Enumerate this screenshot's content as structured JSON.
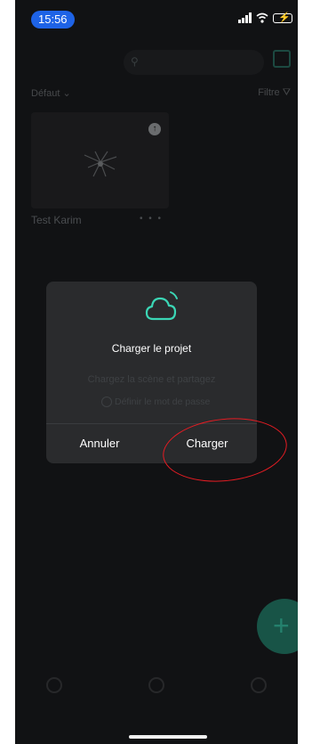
{
  "status_bar": {
    "time": "15:56"
  },
  "header": {
    "logo_text": "",
    "search_placeholder": ""
  },
  "toolbar": {
    "sort_label": "Défaut",
    "filter_label": "Filtre"
  },
  "project": {
    "name": "Test Karim",
    "more": "• • •",
    "date": ""
  },
  "dialog": {
    "title": "Charger le projet",
    "message": "Chargez la scène et partagez",
    "password_option": "Définir le mot de passe",
    "cancel_label": "Annuler",
    "confirm_label": "Charger"
  },
  "nav": [
    {
      "label": "",
      "icon": "home-icon"
    },
    {
      "label": "",
      "icon": "discover-icon"
    },
    {
      "label": "",
      "icon": "profile-icon"
    }
  ],
  "colors": {
    "accent": "#3bd6b5",
    "annotation": "#e51c23",
    "dialog_bg": "#2a2b2d"
  }
}
